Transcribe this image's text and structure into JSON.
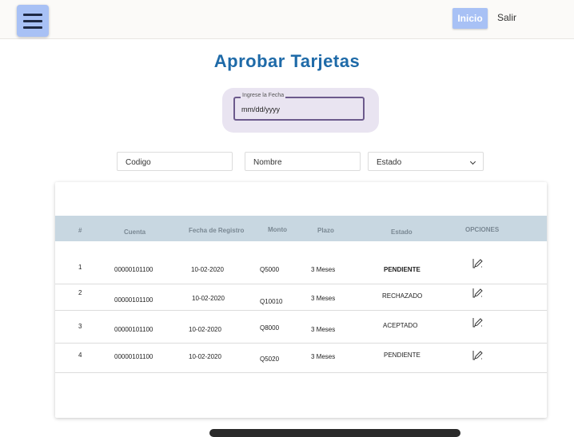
{
  "topbar": {
    "inicio_label": "Inicio",
    "salir_label": "Salir"
  },
  "page": {
    "title": "Aprobar Tarjetas"
  },
  "date_filter": {
    "label": "Ingrese la Fecha",
    "placeholder": "mm/dd/yyyy"
  },
  "filters": {
    "codigo_placeholder": "Codigo",
    "nombre_placeholder": "Nombre",
    "estado_selected": "Estado"
  },
  "table": {
    "headers": [
      "#",
      "Cuenta",
      "Fecha de Registro",
      "Monto",
      "Plazo",
      "Estado",
      "OPCIONES"
    ],
    "rows": [
      {
        "num": "1",
        "cuenta": "00000101100",
        "fecha": "10-02-2020",
        "monto": "Q5000",
        "plazo": "3 Meses",
        "estado": "PENDIENTE"
      },
      {
        "num": "2",
        "cuenta": "00000101100",
        "fecha": "10-02-2020",
        "monto": "Q10010",
        "plazo": "3 Meses",
        "estado": "RECHAZADO"
      },
      {
        "num": "3",
        "cuenta": "00000101100",
        "fecha": "10-02-2020",
        "monto": "Q8000",
        "plazo": "3 Meses",
        "estado": "ACEPTADO"
      },
      {
        "num": "4",
        "cuenta": "00000101100",
        "fecha": "10-02-2020",
        "monto": "Q5020",
        "plazo": "3 Meses",
        "estado": "PENDIENTE"
      }
    ]
  },
  "colors": {
    "accent": "#a8c1f5",
    "title": "#1e6aa8",
    "table_header": "#c8d7e1"
  }
}
